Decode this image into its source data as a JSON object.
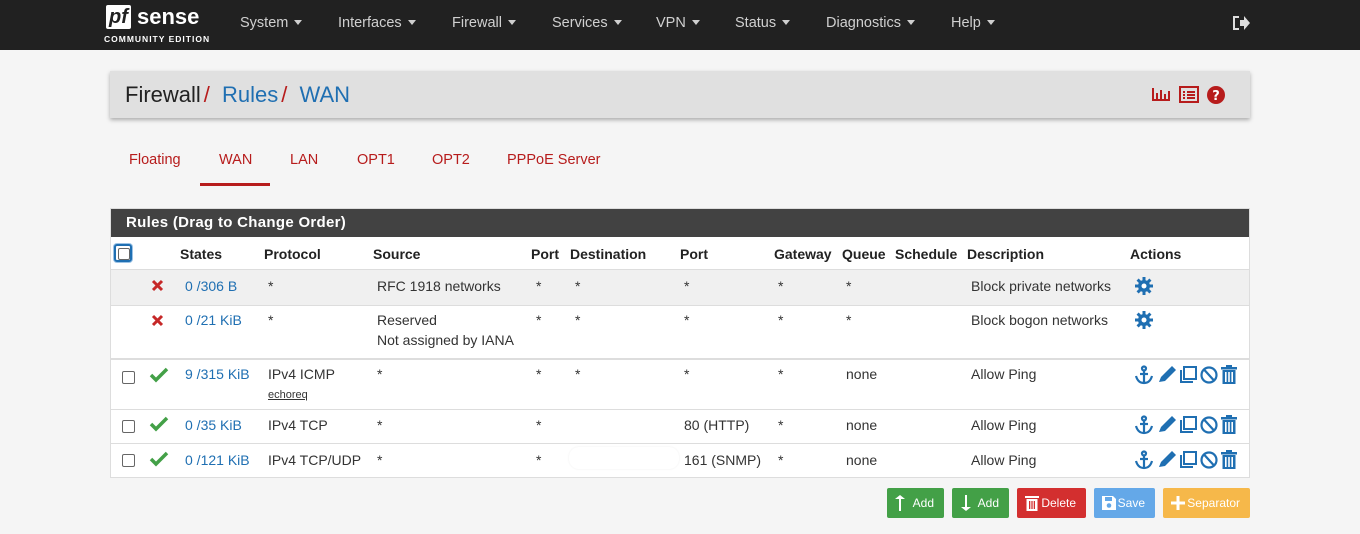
{
  "brand": {
    "logo_pf": "pf",
    "logo_sense": "sense",
    "edition": "COMMUNITY EDITION"
  },
  "nav": {
    "items": [
      "System",
      "Interfaces",
      "Firewall",
      "Services",
      "VPN",
      "Status",
      "Diagnostics",
      "Help"
    ],
    "logout_icon": "sign-out-icon"
  },
  "breadcrumb": {
    "items": [
      "Firewall",
      "Rules",
      "WAN"
    ],
    "separator": "/",
    "icons": [
      "bar-chart-icon",
      "list-icon",
      "help-circle-icon"
    ]
  },
  "tabs": {
    "items": [
      "Floating",
      "WAN",
      "LAN",
      "OPT1",
      "OPT2",
      "PPPoE Server"
    ],
    "active": "WAN"
  },
  "rules": {
    "title": "Rules (Drag to Change Order)",
    "columns": [
      "States",
      "Protocol",
      "Source",
      "Port",
      "Destination",
      "Port",
      "Gateway",
      "Queue",
      "Schedule",
      "Description",
      "Actions"
    ],
    "rows": [
      {
        "status_icon": "times-icon",
        "states": "0 /306 B",
        "protocol": "*",
        "source": "RFC 1918 networks",
        "source2": "",
        "sport": "*",
        "destination": "*",
        "dport": "*",
        "gateway": "*",
        "queue": "*",
        "schedule": "",
        "description": "Block private networks",
        "actions": [
          "gear-icon"
        ]
      },
      {
        "status_icon": "times-icon",
        "states": "0 /21 KiB",
        "protocol": "*",
        "source": "Reserved",
        "source2": "Not assigned by IANA",
        "sport": "*",
        "destination": "*",
        "dport": "*",
        "gateway": "*",
        "queue": "*",
        "schedule": "",
        "description": "Block bogon networks",
        "actions": [
          "gear-icon"
        ]
      },
      {
        "status_icon": "check-icon",
        "states": "9 /315 KiB",
        "protocol": "IPv4 ICMP",
        "protocol_sub": "echoreq",
        "source": "*",
        "sport": "*",
        "destination": "*",
        "dport": "*",
        "gateway": "*",
        "queue": "none",
        "schedule": "",
        "description": "Allow Ping",
        "actions": [
          "anchor-icon",
          "pencil-icon",
          "copy-icon",
          "ban-icon",
          "trash-icon"
        ]
      },
      {
        "status_icon": "check-icon",
        "states": "0 /35 KiB",
        "protocol": "IPv4 TCP",
        "source": "*",
        "sport": "*",
        "destination": "",
        "dport": "80 (HTTP)",
        "gateway": "*",
        "queue": "none",
        "schedule": "",
        "description": "Allow Ping",
        "actions": [
          "anchor-icon",
          "pencil-icon",
          "copy-icon",
          "ban-icon",
          "trash-icon"
        ]
      },
      {
        "status_icon": "check-icon",
        "states": "0 /121 KiB",
        "protocol": "IPv4 TCP/UDP",
        "source": "*",
        "sport": "*",
        "destination": "",
        "dport": "161 (SNMP)",
        "gateway": "*",
        "queue": "none",
        "schedule": "",
        "description": "Allow Ping",
        "actions": [
          "anchor-icon",
          "pencil-icon",
          "copy-icon",
          "ban-icon",
          "trash-icon"
        ]
      }
    ]
  },
  "buttons": [
    {
      "label": "Add",
      "icon": "arrow-up-icon",
      "color": "#43a047"
    },
    {
      "label": "Add",
      "icon": "arrow-down-icon",
      "color": "#43a047"
    },
    {
      "label": "Delete",
      "icon": "trash-icon",
      "color": "#d32f2f"
    },
    {
      "label": "Save",
      "icon": "save-icon",
      "color": "#64a8e8"
    },
    {
      "label": "Separator",
      "icon": "plus-icon",
      "color": "#f6b84a"
    }
  ],
  "colors": {
    "navbar": "#212121",
    "accent_red": "#b71c1c",
    "link_blue": "#1f6fb2",
    "panel_header": "#424242"
  }
}
